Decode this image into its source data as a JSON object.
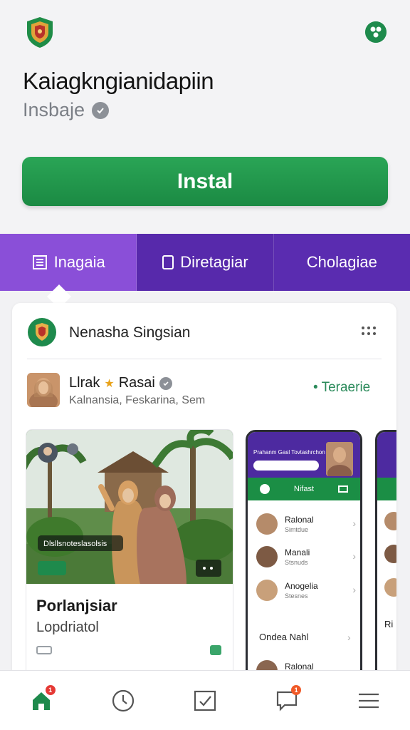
{
  "app": {
    "title": "Kaiagkngianidapiin",
    "subtitle": "Insbaje",
    "install_label": "Instal"
  },
  "tabs": [
    {
      "label": "Inagaia",
      "icon": "book-icon",
      "active": true
    },
    {
      "label": "Diretagiar",
      "icon": "document-icon",
      "active": false
    },
    {
      "label": "Cholagiae",
      "icon": "",
      "active": false
    }
  ],
  "card": {
    "title": "Nenasha Singsian",
    "author": {
      "name": "Llrak",
      "name2": "Rasai",
      "meta": "Kalnansia, Feskarina, Sem"
    },
    "follow_label": "• Teraerie",
    "post": {
      "title": "Porlanjsiar",
      "subtitle": "Lopdriatol",
      "overlay_label": "Dlsllsnoteslasolsis"
    }
  },
  "phone": {
    "header": "Prahanm Gasl Tovtashrchon",
    "tabs": [
      "Nifast"
    ],
    "rows": [
      {
        "name": "Ralonal",
        "meta": "Simtdue"
      },
      {
        "name": "Manali",
        "meta": "Stsnuds"
      },
      {
        "name": "Anogelia",
        "meta": "Stesnes"
      }
    ],
    "plain_rows": [
      "Ondea Nahl",
      "Ralonal"
    ]
  },
  "phone2": {
    "partial_text": "Ri"
  },
  "nav": [
    {
      "icon": "home-icon",
      "badge": "1"
    },
    {
      "icon": "history-icon",
      "badge": ""
    },
    {
      "icon": "mail-check-icon",
      "badge": ""
    },
    {
      "icon": "chat-icon",
      "badge": "1"
    },
    {
      "icon": "menu-icon",
      "badge": ""
    }
  ],
  "colors": {
    "brand_green": "#1e8a4c",
    "tab_purple": "#5d2fb0",
    "tab_active": "#8a4fd8"
  }
}
